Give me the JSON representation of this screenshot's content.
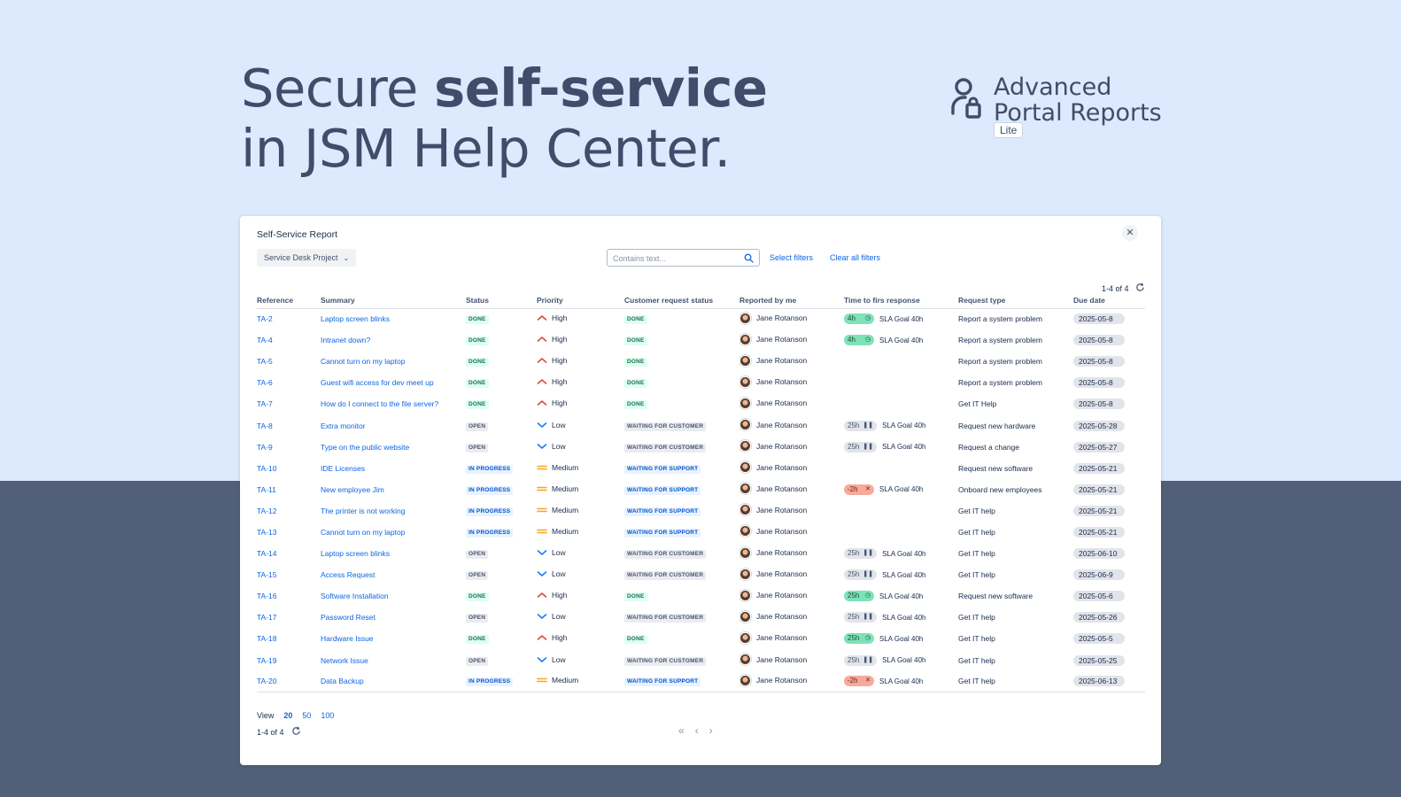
{
  "hero": {
    "line1_prefix": "Secure ",
    "line1_bold": "self-service",
    "line2": "in JSM Help Center."
  },
  "brand": {
    "icon": "user-lock-icon",
    "line1": "Advanced",
    "line2": "Portal Reports",
    "badge": "Lite"
  },
  "report": {
    "title": "Self-Service Report",
    "close_icon": "close-icon",
    "project_select": "Service Desk Project",
    "search_placeholder": "Contains text...",
    "select_filters": "Select filters",
    "clear_filters": "Clear all filters",
    "count": "1-4 of 4",
    "columns": [
      "Reference",
      "Summary",
      "Status",
      "Priority",
      "Customer request status",
      "Reported by me",
      "Time to firs response",
      "Request type",
      "Due date"
    ],
    "rows": [
      {
        "ref": "TA-2",
        "summary": "Laptop screen blinks",
        "status": "DONE",
        "priority": "High",
        "crs": "DONE",
        "reporter": "Jane Rotanson",
        "sla_time": "4h",
        "sla_state": "met",
        "sla_goal": "SLA Goal 40h",
        "rtype": "Report a system problem",
        "due": "2025-05-8"
      },
      {
        "ref": "TA-4",
        "summary": "Intranet down?",
        "status": "DONE",
        "priority": "High",
        "crs": "DONE",
        "reporter": "Jane Rotanson",
        "sla_time": "4h",
        "sla_state": "met",
        "sla_goal": "SLA Goal 40h",
        "rtype": "Report a system problem",
        "due": "2025-05-8"
      },
      {
        "ref": "TA-5",
        "summary": "Cannot turn on my laptop",
        "status": "DONE",
        "priority": "High",
        "crs": "DONE",
        "reporter": "Jane Rotanson",
        "sla_time": "",
        "sla_state": "",
        "sla_goal": "",
        "rtype": "Report a system problem",
        "due": "2025-05-8"
      },
      {
        "ref": "TA-6",
        "summary": "Guest wifi access for dev meet up",
        "status": "DONE",
        "priority": "High",
        "crs": "DONE",
        "reporter": "Jane Rotanson",
        "sla_time": "",
        "sla_state": "",
        "sla_goal": "",
        "rtype": "Report a system problem",
        "due": "2025-05-8"
      },
      {
        "ref": "TA-7",
        "summary": "How do I connect to the file server?",
        "status": "DONE",
        "priority": "High",
        "crs": "DONE",
        "reporter": "Jane Rotanson",
        "sla_time": "",
        "sla_state": "",
        "sla_goal": "",
        "rtype": "Get IT Help",
        "due": "2025-05-8"
      },
      {
        "ref": "TA-8",
        "summary": "Extra monitor",
        "status": "OPEN",
        "priority": "Low",
        "crs": "WAITING FOR CUSTOMER",
        "reporter": "Jane Rotanson",
        "sla_time": "25h",
        "sla_state": "paused",
        "sla_goal": "SLA Goal 40h",
        "rtype": "Request new hardware",
        "due": "2025-05-28"
      },
      {
        "ref": "TA-9",
        "summary": "Type on the public website",
        "status": "OPEN",
        "priority": "Low",
        "crs": "WAITING FOR CUSTOMER",
        "reporter": "Jane Rotanson",
        "sla_time": "25h",
        "sla_state": "paused",
        "sla_goal": "SLA Goal 40h",
        "rtype": "Request a change",
        "due": "2025-05-27"
      },
      {
        "ref": "TA-10",
        "summary": "IDE Licenses",
        "status": "IN PROGRESS",
        "priority": "Medium",
        "crs": "WAITING FOR SUPPORT",
        "reporter": "Jane Rotanson",
        "sla_time": "",
        "sla_state": "",
        "sla_goal": "",
        "rtype": "Request new software",
        "due": "2025-05-21"
      },
      {
        "ref": "TA-11",
        "summary": "New employee Jim",
        "status": "IN PROGRESS",
        "priority": "Medium",
        "crs": "WAITING FOR SUPPORT",
        "reporter": "Jane Rotanson",
        "sla_time": "-2h",
        "sla_state": "breached",
        "sla_goal": "SLA Goal 40h",
        "rtype": "Onboard new employees",
        "due": "2025-05-21"
      },
      {
        "ref": "TA-12",
        "summary": "The printer is not working",
        "status": "IN PROGRESS",
        "priority": "Medium",
        "crs": "WAITING FOR SUPPORT",
        "reporter": "Jane Rotanson",
        "sla_time": "",
        "sla_state": "",
        "sla_goal": "",
        "rtype": "Get IT help",
        "due": "2025-05-21"
      },
      {
        "ref": "TA-13",
        "summary": "Cannot turn on my laptop",
        "status": "IN PROGRESS",
        "priority": "Medium",
        "crs": "WAITING FOR SUPPORT",
        "reporter": "Jane Rotanson",
        "sla_time": "",
        "sla_state": "",
        "sla_goal": "",
        "rtype": "Get IT help",
        "due": "2025-05-21"
      },
      {
        "ref": "TA-14",
        "summary": "Laptop screen blinks",
        "status": "OPEN",
        "priority": "Low",
        "crs": "WAITING FOR CUSTOMER",
        "reporter": "Jane Rotanson",
        "sla_time": "25h",
        "sla_state": "paused",
        "sla_goal": "SLA Goal 40h",
        "rtype": "Get IT help",
        "due": "2025-06-10"
      },
      {
        "ref": "TA-15",
        "summary": "Access Request",
        "status": "OPEN",
        "priority": "Low",
        "crs": "WAITING FOR CUSTOMER",
        "reporter": "Jane Rotanson",
        "sla_time": "25h",
        "sla_state": "paused",
        "sla_goal": "SLA Goal 40h",
        "rtype": "Get IT help",
        "due": "2025-06-9"
      },
      {
        "ref": "TA-16",
        "summary": "Software Installation",
        "status": "DONE",
        "priority": "High",
        "crs": "DONE",
        "reporter": "Jane Rotanson",
        "sla_time": "25h",
        "sla_state": "met",
        "sla_goal": "SLA Goal 40h",
        "rtype": "Request new software",
        "due": "2025-05-6"
      },
      {
        "ref": "TA-17",
        "summary": "Password Reset",
        "status": "OPEN",
        "priority": "Low",
        "crs": "WAITING FOR CUSTOMER",
        "reporter": "Jane Rotanson",
        "sla_time": "25h",
        "sla_state": "paused",
        "sla_goal": "SLA Goal 40h",
        "rtype": "Get IT help",
        "due": "2025-05-26"
      },
      {
        "ref": "TA-18",
        "summary": "Hardware Issue",
        "status": "DONE",
        "priority": "High",
        "crs": "DONE",
        "reporter": "Jane Rotanson",
        "sla_time": "25h",
        "sla_state": "met",
        "sla_goal": "SLA Goal 40h",
        "rtype": "Get IT help",
        "due": "2025-05-5"
      },
      {
        "ref": "TA-19",
        "summary": "Network Issue",
        "status": "OPEN",
        "priority": "Low",
        "crs": "WAITING FOR CUSTOMER",
        "reporter": "Jane Rotanson",
        "sla_time": "25h",
        "sla_state": "paused",
        "sla_goal": "SLA Goal 40h",
        "rtype": "Get IT help",
        "due": "2025-05-25"
      },
      {
        "ref": "TA-20",
        "summary": "Data Backup",
        "status": "IN PROGRESS",
        "priority": "Medium",
        "crs": "WAITING FOR SUPPORT",
        "reporter": "Jane Rotanson",
        "sla_time": "-2h",
        "sla_state": "breached",
        "sla_goal": "SLA Goal 40h",
        "rtype": "Get IT help",
        "due": "2025-06-13"
      }
    ],
    "view_label": "View",
    "view_options": [
      "20",
      "50",
      "100"
    ],
    "view_selected": "20",
    "pager_icons": [
      "double-chevron-left-icon",
      "chevron-left-icon",
      "chevron-right-icon"
    ],
    "pager_glyphs": [
      "«",
      "‹",
      "›"
    ]
  },
  "colors": {
    "bg_top": "#dde9fc",
    "bg_bottom": "#525f78",
    "link": "#0c66e4",
    "priority_high": "#e2483d",
    "priority_medium": "#f5a623",
    "priority_low": "#1d7afc"
  }
}
